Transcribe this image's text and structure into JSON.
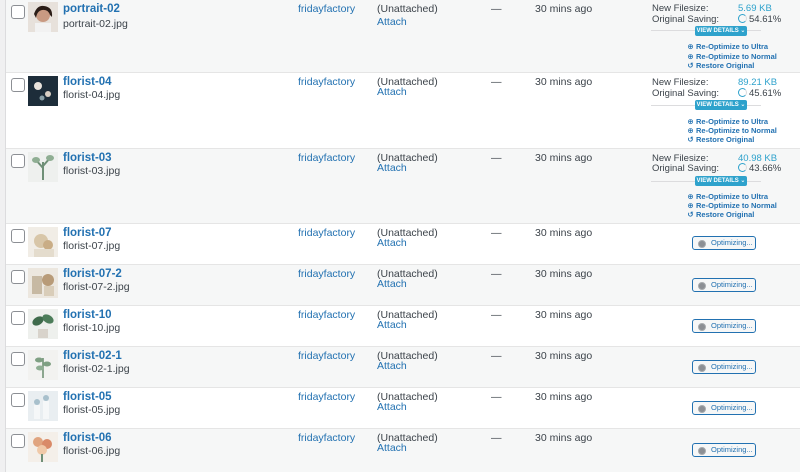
{
  "rows": [
    {
      "title": "portrait-02",
      "file": "portrait-02.jpg",
      "author": "fridayfactory",
      "uploaded_to": "(Unattached)",
      "attach": "Attach",
      "dash": "—",
      "date": "30 mins ago",
      "status": "optimized",
      "new_filesize_label": "New Filesize:",
      "new_filesize": "5.69 KB",
      "saving_label": "Original Saving:",
      "saving": "54.61%",
      "view_details": "VIEW DETAILS ⌄",
      "actions": [
        "Re-Optimize to Ultra",
        "Re-Optimize to Normal",
        "Restore Original"
      ]
    },
    {
      "title": "florist-04",
      "file": "florist-04.jpg",
      "author": "fridayfactory",
      "uploaded_to": "(Unattached)",
      "attach": "Attach",
      "dash": "—",
      "date": "30 mins ago",
      "status": "optimized",
      "new_filesize_label": "New Filesize:",
      "new_filesize": "89.21 KB",
      "saving_label": "Original Saving:",
      "saving": "45.61%",
      "view_details": "VIEW DETAILS ⌄",
      "actions": [
        "Re-Optimize to Ultra",
        "Re-Optimize to Normal",
        "Restore Original"
      ]
    },
    {
      "title": "florist-03",
      "file": "florist-03.jpg",
      "author": "fridayfactory",
      "uploaded_to": "(Unattached)",
      "attach": "Attach",
      "dash": "—",
      "date": "30 mins ago",
      "status": "optimized",
      "new_filesize_label": "New Filesize:",
      "new_filesize": "40.98 KB",
      "saving_label": "Original Saving:",
      "saving": "43.66%",
      "view_details": "VIEW DETAILS ⌄",
      "actions": [
        "Re-Optimize to Ultra",
        "Re-Optimize to Normal",
        "Restore Original"
      ]
    },
    {
      "title": "florist-07",
      "file": "florist-07.jpg",
      "author": "fridayfactory",
      "uploaded_to": "(Unattached)",
      "attach": "Attach",
      "dash": "—",
      "date": "30 mins ago",
      "status": "optimizing",
      "optimizing_label": "Optimizing..."
    },
    {
      "title": "florist-07-2",
      "file": "florist-07-2.jpg",
      "author": "fridayfactory",
      "uploaded_to": "(Unattached)",
      "attach": "Attach",
      "dash": "—",
      "date": "30 mins ago",
      "status": "optimizing",
      "optimizing_label": "Optimizing..."
    },
    {
      "title": "florist-10",
      "file": "florist-10.jpg",
      "author": "fridayfactory",
      "uploaded_to": "(Unattached)",
      "attach": "Attach",
      "dash": "—",
      "date": "30 mins ago",
      "status": "optimizing",
      "optimizing_label": "Optimizing..."
    },
    {
      "title": "florist-02-1",
      "file": "florist-02-1.jpg",
      "author": "fridayfactory",
      "uploaded_to": "(Unattached)",
      "attach": "Attach",
      "dash": "—",
      "date": "30 mins ago",
      "status": "optimizing",
      "optimizing_label": "Optimizing..."
    },
    {
      "title": "florist-05",
      "file": "florist-05.jpg",
      "author": "fridayfactory",
      "uploaded_to": "(Unattached)",
      "attach": "Attach",
      "dash": "—",
      "date": "30 mins ago",
      "status": "optimizing",
      "optimizing_label": "Optimizing..."
    },
    {
      "title": "florist-06",
      "file": "florist-06.jpg",
      "author": "fridayfactory",
      "uploaded_to": "(Unattached)",
      "attach": "Attach",
      "dash": "—",
      "date": "30 mins ago",
      "status": "optimizing",
      "optimizing_label": "Optimizing..."
    }
  ],
  "icons": {
    "reoptimize": "plus-circle-icon",
    "restore": "undo-icon",
    "optimizing": "spinner-icon"
  },
  "colors": {
    "link": "#2271b1",
    "accent": "#2ea2cc",
    "alt_row": "#f6f7f7"
  }
}
